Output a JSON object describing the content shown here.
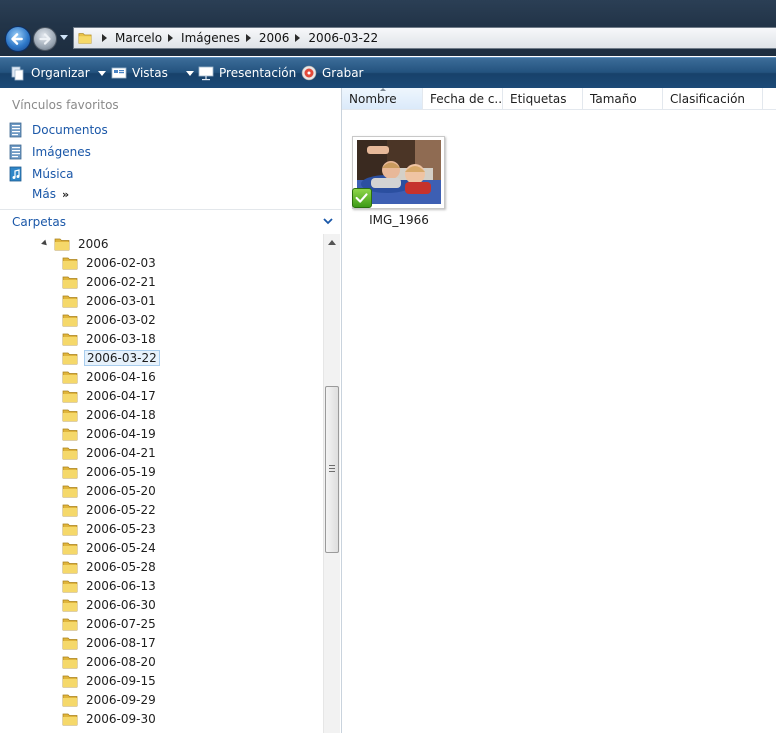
{
  "breadcrumb": {
    "items": [
      "Marcelo",
      "Imágenes",
      "2006",
      "2006-03-22"
    ]
  },
  "toolbar": {
    "organize_label": "Organizar",
    "views_label": "Vistas",
    "slideshow_label": "Presentación",
    "burn_label": "Grabar"
  },
  "favorites": {
    "title": "Vínculos favoritos",
    "items": [
      {
        "label": "Documentos",
        "icon": "documents-icon"
      },
      {
        "label": "Imágenes",
        "icon": "pictures-icon"
      },
      {
        "label": "Música",
        "icon": "music-icon"
      }
    ],
    "more_label": "Más",
    "more_chevron": "»"
  },
  "folders": {
    "title": "Carpetas",
    "parent": "2006",
    "selected": "2006-03-22",
    "items": [
      "2006-02-03",
      "2006-02-21",
      "2006-03-01",
      "2006-03-02",
      "2006-03-18",
      "2006-03-22",
      "2006-04-16",
      "2006-04-17",
      "2006-04-18",
      "2006-04-19",
      "2006-04-21",
      "2006-05-19",
      "2006-05-20",
      "2006-05-22",
      "2006-05-23",
      "2006-05-24",
      "2006-05-28",
      "2006-06-13",
      "2006-06-30",
      "2006-07-25",
      "2006-08-17",
      "2006-08-20",
      "2006-09-15",
      "2006-09-29",
      "2006-09-30"
    ]
  },
  "columns": [
    "Nombre",
    "Fecha de c...",
    "Etiquetas",
    "Tamaño",
    "Clasificación"
  ],
  "files": [
    {
      "name": "IMG_1966"
    }
  ],
  "colors": {
    "link_blue": "#1a57a8",
    "command_bar": "#23527e",
    "selection": "#e6f1fb"
  }
}
